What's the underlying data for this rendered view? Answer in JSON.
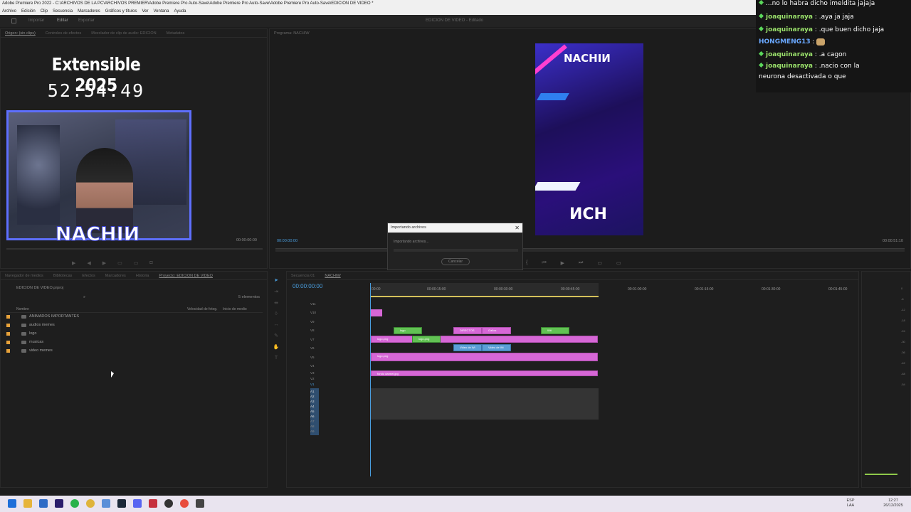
{
  "window": {
    "title": "Adobe Premiere Pro 2022 - C:\\ARCHIVOS DE LA PC\\ARCHIVOS PREMIER\\Adobe Premiere Pro Auto-Save\\Adobe Premiere Pro Auto-Save\\Adobe Premiere Pro Auto-Save\\EDICION DE VIDEO *",
    "menu": [
      "Archivo",
      "Edición",
      "Clip",
      "Secuencia",
      "Marcadores",
      "Gráficos y títulos",
      "Ver",
      "Ventana",
      "Ayuda"
    ],
    "workspaces": [
      "Importar",
      "Editar",
      "Exportar"
    ],
    "center_title": "EDICION DE VIDEO - Editado"
  },
  "source_panel": {
    "tabs": [
      "Origen: (sin clips)",
      "Controles de efectos",
      "Mezclador de clip de audio: EDICION",
      "Metadatos"
    ],
    "timecode_right": "00:00:00:00"
  },
  "program_panel": {
    "tab": "Programa: NACHIW",
    "timecode_left": "00:00:00:00",
    "timecode_right": "00:00:51:10"
  },
  "overlay": {
    "timer_title": "Extensible 2025",
    "timer_value": "52:54:49",
    "cam_label": "NACHIИ"
  },
  "preview": {
    "top_text": "NACHIИ",
    "bottom_text": "ИCH"
  },
  "chat": [
    {
      "user": "",
      "text": "...no lo habra dicho imeldita jajaja"
    },
    {
      "user": "joaquinaraya",
      "text": ": .aya ja jaja"
    },
    {
      "user": "joaquinaraya",
      "text": ": .que buen dicho jaja"
    },
    {
      "user": "HONGMENG13",
      "text": ":"
    },
    {
      "user": "joaquinaraya",
      "text": ": .a cagon"
    },
    {
      "user": "joaquinaraya",
      "text": ": .nacio con la neurona desactivada o que"
    }
  ],
  "dialog": {
    "title": "Importando archivos",
    "message": "Importando archivos...",
    "cancel": "Cancelar"
  },
  "project": {
    "tabs": [
      "Navegador de medios",
      "Bibliotecas",
      "Efectos",
      "Marcadores",
      "Historia",
      "Proyecto: EDICION DE VIDEO"
    ],
    "file": "EDICION DE VIDEO.prproj",
    "count": "5 elementos",
    "columns": [
      "Nombre",
      "Velocidad de fotog.",
      "Inicio de medio"
    ],
    "items": [
      "ANIMADOS IMPORTANTES",
      "audios memes",
      "logo",
      "musicas",
      "video memes"
    ]
  },
  "timeline": {
    "tabs": [
      "Secuencia 01",
      "NACHIW"
    ],
    "timecode": "00:00:00:00",
    "ruler": [
      "00:00",
      "00:00:15:00",
      "00:00:30:00",
      "00:00:45:00",
      "00:01:00:00",
      "00:01:15:00",
      "00:01:30:00",
      "00:01:45:00"
    ],
    "video_tracks": [
      "V11",
      "V10",
      "V9",
      "V8",
      "V7",
      "V6",
      "V5",
      "V4",
      "V3",
      "V2",
      "V1"
    ],
    "audio_tracks": [
      "A1",
      "A2",
      "A3",
      "A4",
      "A5",
      "A6",
      "A7",
      "A8",
      "A9"
    ],
    "clips": {
      "c1": "logo",
      "c2": "DIRECTOS",
      "c3": "Gallos",
      "c4": "logo.png",
      "c5": "logo.png",
      "c6": "Video de Wi",
      "c7": "Video de Wi",
      "c8": "logo.png",
      "c9": "fondo darmel.jpg",
      "c10": "Wit"
    }
  },
  "meters": [
    "0",
    "-6",
    "-12",
    "-18",
    "-24",
    "-30",
    "-36",
    "-42",
    "-48",
    "-54"
  ],
  "taskbar": {
    "lang": "ESP",
    "lang2": "LAA",
    "time": "12:27",
    "date": "26/12/2025"
  }
}
